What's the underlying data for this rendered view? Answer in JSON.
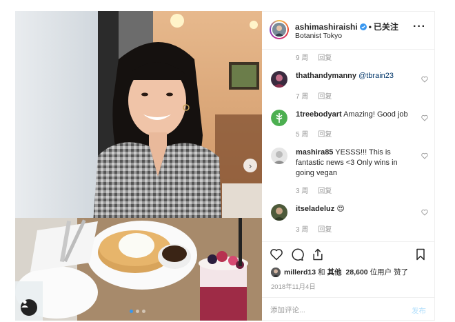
{
  "post": {
    "author": "ashimashiraishi",
    "separator": "•",
    "follow_state": "已关注",
    "location": "Botanist Tokyo",
    "more_icon": "more-horizontal-icon"
  },
  "comments": [
    {
      "user": "",
      "text": "",
      "age": "9 周",
      "reply": "回复"
    },
    {
      "user": "thathandymanny",
      "mention": "@tbrain23",
      "text": "",
      "age": "7 周",
      "reply": "回复"
    },
    {
      "user": "1treebodyart",
      "text": "Amazing! Good job",
      "age": "5 周",
      "reply": "回复"
    },
    {
      "user": "mashira85",
      "text": "YESSS!!! This is fantastic news <3 Only wins in going vegan",
      "age": "3 周",
      "reply": "回复"
    },
    {
      "user": "itseladeluz",
      "text": "😍",
      "age": "3 周",
      "reply": "回复"
    }
  ],
  "actions": {
    "icons": [
      "heart-icon",
      "comment-icon",
      "share-icon",
      "bookmark-icon"
    ]
  },
  "likes": {
    "user": "millerd13",
    "connector": "和",
    "others_prefix": "其他",
    "count": "28,600",
    "suffix": "位用户 赞了"
  },
  "date": "2018年11月4日",
  "comment_box": {
    "placeholder": "添加评论...",
    "post_label": "发布"
  },
  "colors": {
    "accent": "#3897f0",
    "verified": "#3897f0",
    "mention": "#003569",
    "post_disabled": "#b2dffc"
  },
  "carousel": {
    "count": 3,
    "active": 1
  }
}
